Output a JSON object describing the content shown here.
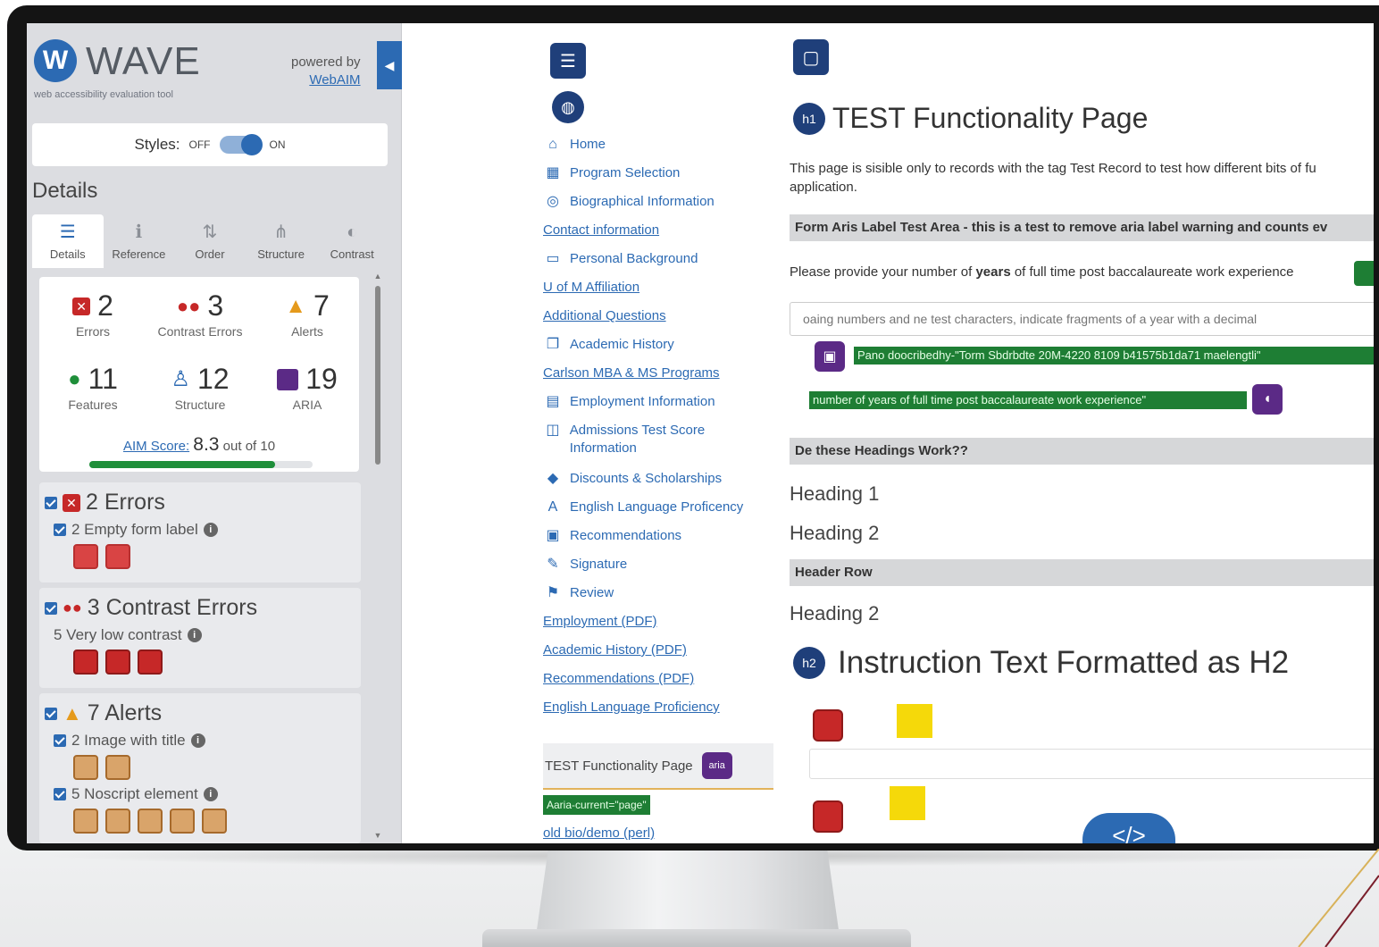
{
  "wave": {
    "logo_letter": "W",
    "title": "WAVE",
    "subtitle": "web accessibility evaluation tool",
    "powered_by": "powered by",
    "webaim": "WebAIM",
    "collapse": "◀",
    "styles_label": "Styles:",
    "styles_off": "OFF",
    "styles_on": "ON",
    "details_title": "Details",
    "tabs": [
      {
        "label": "Details",
        "icon": "☰"
      },
      {
        "label": "Reference",
        "icon": "ℹ"
      },
      {
        "label": "Order",
        "icon": "⇅"
      },
      {
        "label": "Structure",
        "icon": "⋔"
      },
      {
        "label": "Contrast",
        "icon": "◐"
      }
    ],
    "summary": {
      "errors": {
        "count": "2",
        "label": "Errors"
      },
      "contrast": {
        "count": "3",
        "label": "Contrast Errors"
      },
      "alerts": {
        "count": "7",
        "label": "Alerts"
      },
      "features": {
        "count": "11",
        "label": "Features"
      },
      "structure": {
        "count": "12",
        "label": "Structure"
      },
      "aria": {
        "count": "19",
        "label": "ARIA"
      }
    },
    "aim_label": "AIM Score:",
    "aim_score": "8.3",
    "aim_suffix": "out of 10",
    "aim_fraction": 0.83,
    "groups": {
      "errors": {
        "title": "2 Errors",
        "sub": "2 Empty form label"
      },
      "contrast": {
        "title": "3 Contrast Errors",
        "sub": "5 Very low contrast"
      },
      "alerts": {
        "title": "7 Alerts",
        "sub1": "2 Image with title",
        "sub2": "5 Noscript element"
      }
    }
  },
  "nav": {
    "items": [
      {
        "label": "Home",
        "icon": "⌂"
      },
      {
        "label": "Program Selection",
        "icon": "▦"
      },
      {
        "label": "Biographical Information",
        "icon": "◎"
      },
      {
        "label": "Contact information",
        "icon": ""
      },
      {
        "label": "Personal Background",
        "icon": "▭"
      },
      {
        "label": "U of M Affiliation",
        "icon": ""
      },
      {
        "label": "Additional Questions",
        "icon": ""
      },
      {
        "label": "Academic History",
        "icon": "❐"
      },
      {
        "label": "Carlson MBA & MS Programs",
        "icon": ""
      },
      {
        "label": "Employment Information",
        "icon": "▤"
      },
      {
        "label": "Admissions Test Score Information",
        "icon": "◫"
      },
      {
        "label": "Discounts & Scholarships",
        "icon": "◆"
      },
      {
        "label": "English Language Proficency",
        "icon": "A"
      },
      {
        "label": "Recommendations",
        "icon": "▣"
      },
      {
        "label": "Signature",
        "icon": "✎"
      },
      {
        "label": "Review",
        "icon": "⚑"
      },
      {
        "label": "Employment (PDF)",
        "icon": ""
      },
      {
        "label": "Academic History (PDF)",
        "icon": ""
      },
      {
        "label": "Recommendations (PDF)",
        "icon": ""
      },
      {
        "label": "English Language Proficiency",
        "icon": ""
      }
    ],
    "current": "TEST Functionality Page",
    "aria_badge": "aria",
    "aria_tag": "Aaria-current=\"page\"",
    "last_link": "old bio/demo (perl)"
  },
  "main": {
    "h1_badge": "h1",
    "h1": "TEST Functionality Page",
    "intro_line1": "This page is sisible only to records with the tag Test Record to test how different bits of fu",
    "intro_line2": "application.",
    "bar1": "Form Aris Label Test Area - this is a test to remove aria label warning and counts ev",
    "question_pre": "Please provide your number of ",
    "question_bold": "years",
    "question_post": " of full time post baccalaureate work experience",
    "input_placeholder": "oaing numbers and ne test characters, indicate fragments of a year with a decimal",
    "aria_describedby": "Pano doocribedhy-\"Torm Sbdrbdte 20M-4220 8109 b41575b1da71 maelengtli\"",
    "aria_label": "number of years of full time post baccalaureate work experience\"",
    "bar2": "De these Headings Work??",
    "heading1": "Heading 1",
    "heading2a": "Heading 2",
    "bar3": "Header Row",
    "heading2b": "Heading 2",
    "h2_badge": "h2",
    "h2": "Instruction Text Formatted as H2",
    "code_button": "</>"
  }
}
